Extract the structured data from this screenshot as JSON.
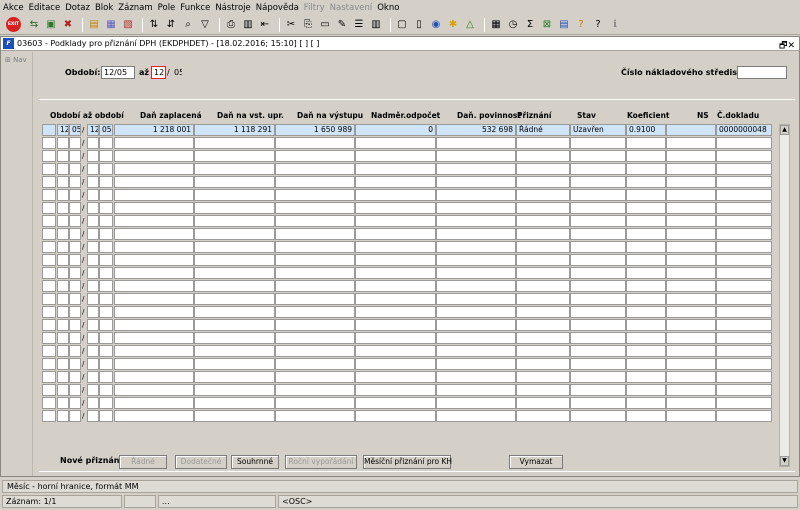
{
  "menu": [
    "Akce",
    "Editace",
    "Dotaz",
    "Blok",
    "Záznam",
    "Pole",
    "Funkce",
    "Nástroje",
    "Nápověda",
    "Filtry",
    "Nastavení",
    "Okno"
  ],
  "menu_disabled": [
    "Filtry",
    "Nastavení"
  ],
  "toolbar_exit_label": "EXIT",
  "window": {
    "title": "03603 - Podklady pro přiznání DPH (EKDPHDET) - [18.02.2016; 15:10] [ ] [ ]",
    "nav_label": "Nav",
    "controls": "🗗✕"
  },
  "filter": {
    "obdobi_label": "Období:",
    "obdobi_from": "12/05",
    "az_label": "až",
    "obdobi_to_month": "12",
    "obdobi_to_year": "05",
    "obdobi_to_sep": "/",
    "cost_center_label": "Číslo nákladového střediska",
    "cost_center_value": ""
  },
  "columns": {
    "obdobi_az_obdobi": "Období až období",
    "dan_zaplacena": "Daň zaplacená",
    "dan_vst_upr": "Daň na vst. upr.",
    "dan_vystupu": "Daň na výstupu",
    "nadmer": "Nadměr.odpočet",
    "dan_povinnost": "Daň. povinnost",
    "priznani": "Přiznání",
    "stav": "Stav",
    "koeficient": "Koeficient",
    "ns": "NS",
    "c_dokladu": "Č.dokladu"
  },
  "rows": [
    {
      "from_month": "12",
      "from_year": "05",
      "to_month": "12",
      "to_year": "05",
      "dan_zaplacena": "1 218 001",
      "dan_vst_upr": "1 118 291",
      "dan_vystupu": "1 650 989",
      "nadmer": "0",
      "dan_povinnost": "532 698",
      "priznani": "Řádné",
      "stav": "Uzavřen",
      "koeficient": "0.9100",
      "ns": "",
      "c_dokladu": "0000000048"
    }
  ],
  "empty_row_count": 22,
  "buttons": {
    "nove_priznani_label": "Nové přiznání",
    "radne": "Řádné",
    "dodatecne": "Dodatečné",
    "souhrnne": "Souhrnné",
    "rocni": "Roční vypořádání",
    "mesicni_kh": "Měsíční přiznání pro KH",
    "vymazat": "Vymazat"
  },
  "status": {
    "hint": "Měsíc - horní hranice, formát MM",
    "record": "Záznam: 1/1",
    "ellipsis": "...",
    "osc": "<OSC>"
  }
}
